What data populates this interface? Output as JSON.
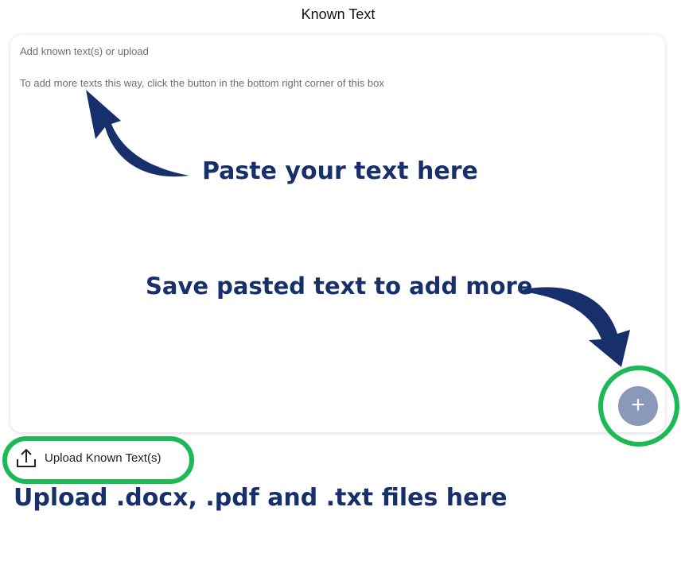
{
  "section": {
    "title": "Known Text"
  },
  "text_box": {
    "placeholder_line1": "Add known text(s) or upload",
    "placeholder_line2": "To add more texts this way, click the button in the bottom right corner of this box"
  },
  "annotations": {
    "paste": "Paste your text here",
    "save": "Save pasted text to add more",
    "upload": "Upload .docx, .pdf and .txt files here"
  },
  "buttons": {
    "add_symbol": "+",
    "upload_label": "Upload Known Text(s)"
  },
  "icons": {
    "add": "plus-icon",
    "upload": "upload-icon",
    "arrows": "curved-arrow-icon"
  },
  "colors": {
    "annotation": "#17306b",
    "highlight_ring": "#1db954",
    "add_button": "#8a99b7"
  }
}
